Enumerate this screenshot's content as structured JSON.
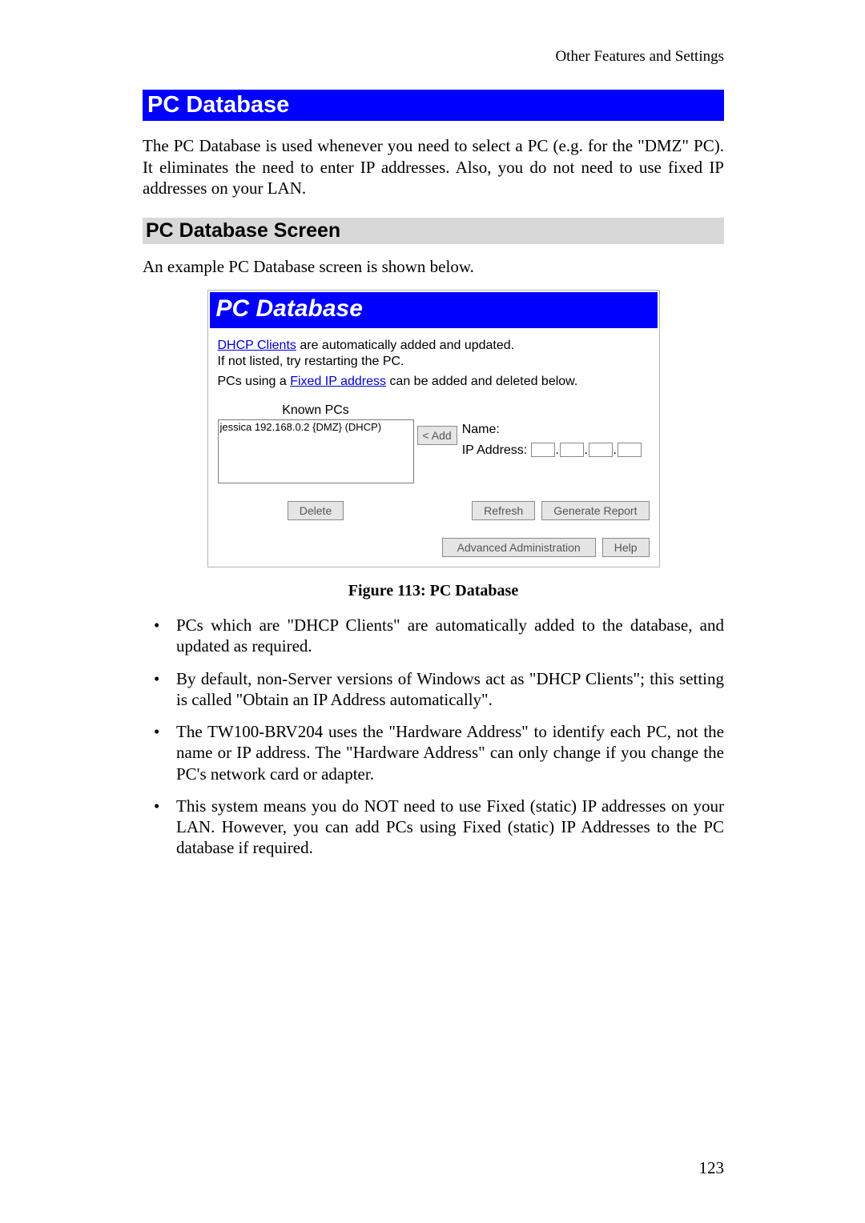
{
  "header": {
    "right_text": "Other Features and Settings"
  },
  "banner": {
    "title": "PC Database"
  },
  "intro": "The PC Database is used whenever you need to select a PC (e.g. for the \"DMZ\" PC). It eliminates the need to enter IP addresses. Also, you do not need to use fixed IP addresses on your LAN.",
  "subheading": "PC Database Screen",
  "subintro": "An example PC Database screen is shown below.",
  "figure": {
    "title": "PC Database",
    "line1_link": "DHCP Clients",
    "line1_rest": " are automatically added and updated.",
    "line2": "If not listed, try restarting the PC.",
    "line3_pre": "PCs using a ",
    "line3_link": "Fixed IP address",
    "line3_post": " can be added and deleted below.",
    "known_label": "Known PCs",
    "known_entry": "jessica 192.168.0.2 {DMZ} (DHCP)",
    "add_btn": "< Add",
    "name_label": "Name:",
    "ip_label": "IP Address:",
    "delete_btn": "Delete",
    "refresh_btn": "Refresh",
    "generate_btn": "Generate Report",
    "advadmin_btn": "Advanced Administration",
    "help_btn": "Help"
  },
  "caption": "Figure 113: PC Database",
  "bullets": [
    "PCs which are \"DHCP Clients\" are automatically added to the database, and updated as required.",
    "By default, non-Server versions of Windows act as \"DHCP Clients\"; this setting is called \"Obtain an IP Address automatically\".",
    "The TW100-BRV204  uses the \"Hardware Address\" to identify each PC, not the name or IP address. The \"Hardware Address\" can only change if you change the PC's network card or adapter.",
    "This system means you do NOT need to use Fixed (static) IP addresses on your LAN. However, you can add PCs using Fixed (static) IP Addresses to the PC database if required."
  ],
  "page_number": "123"
}
